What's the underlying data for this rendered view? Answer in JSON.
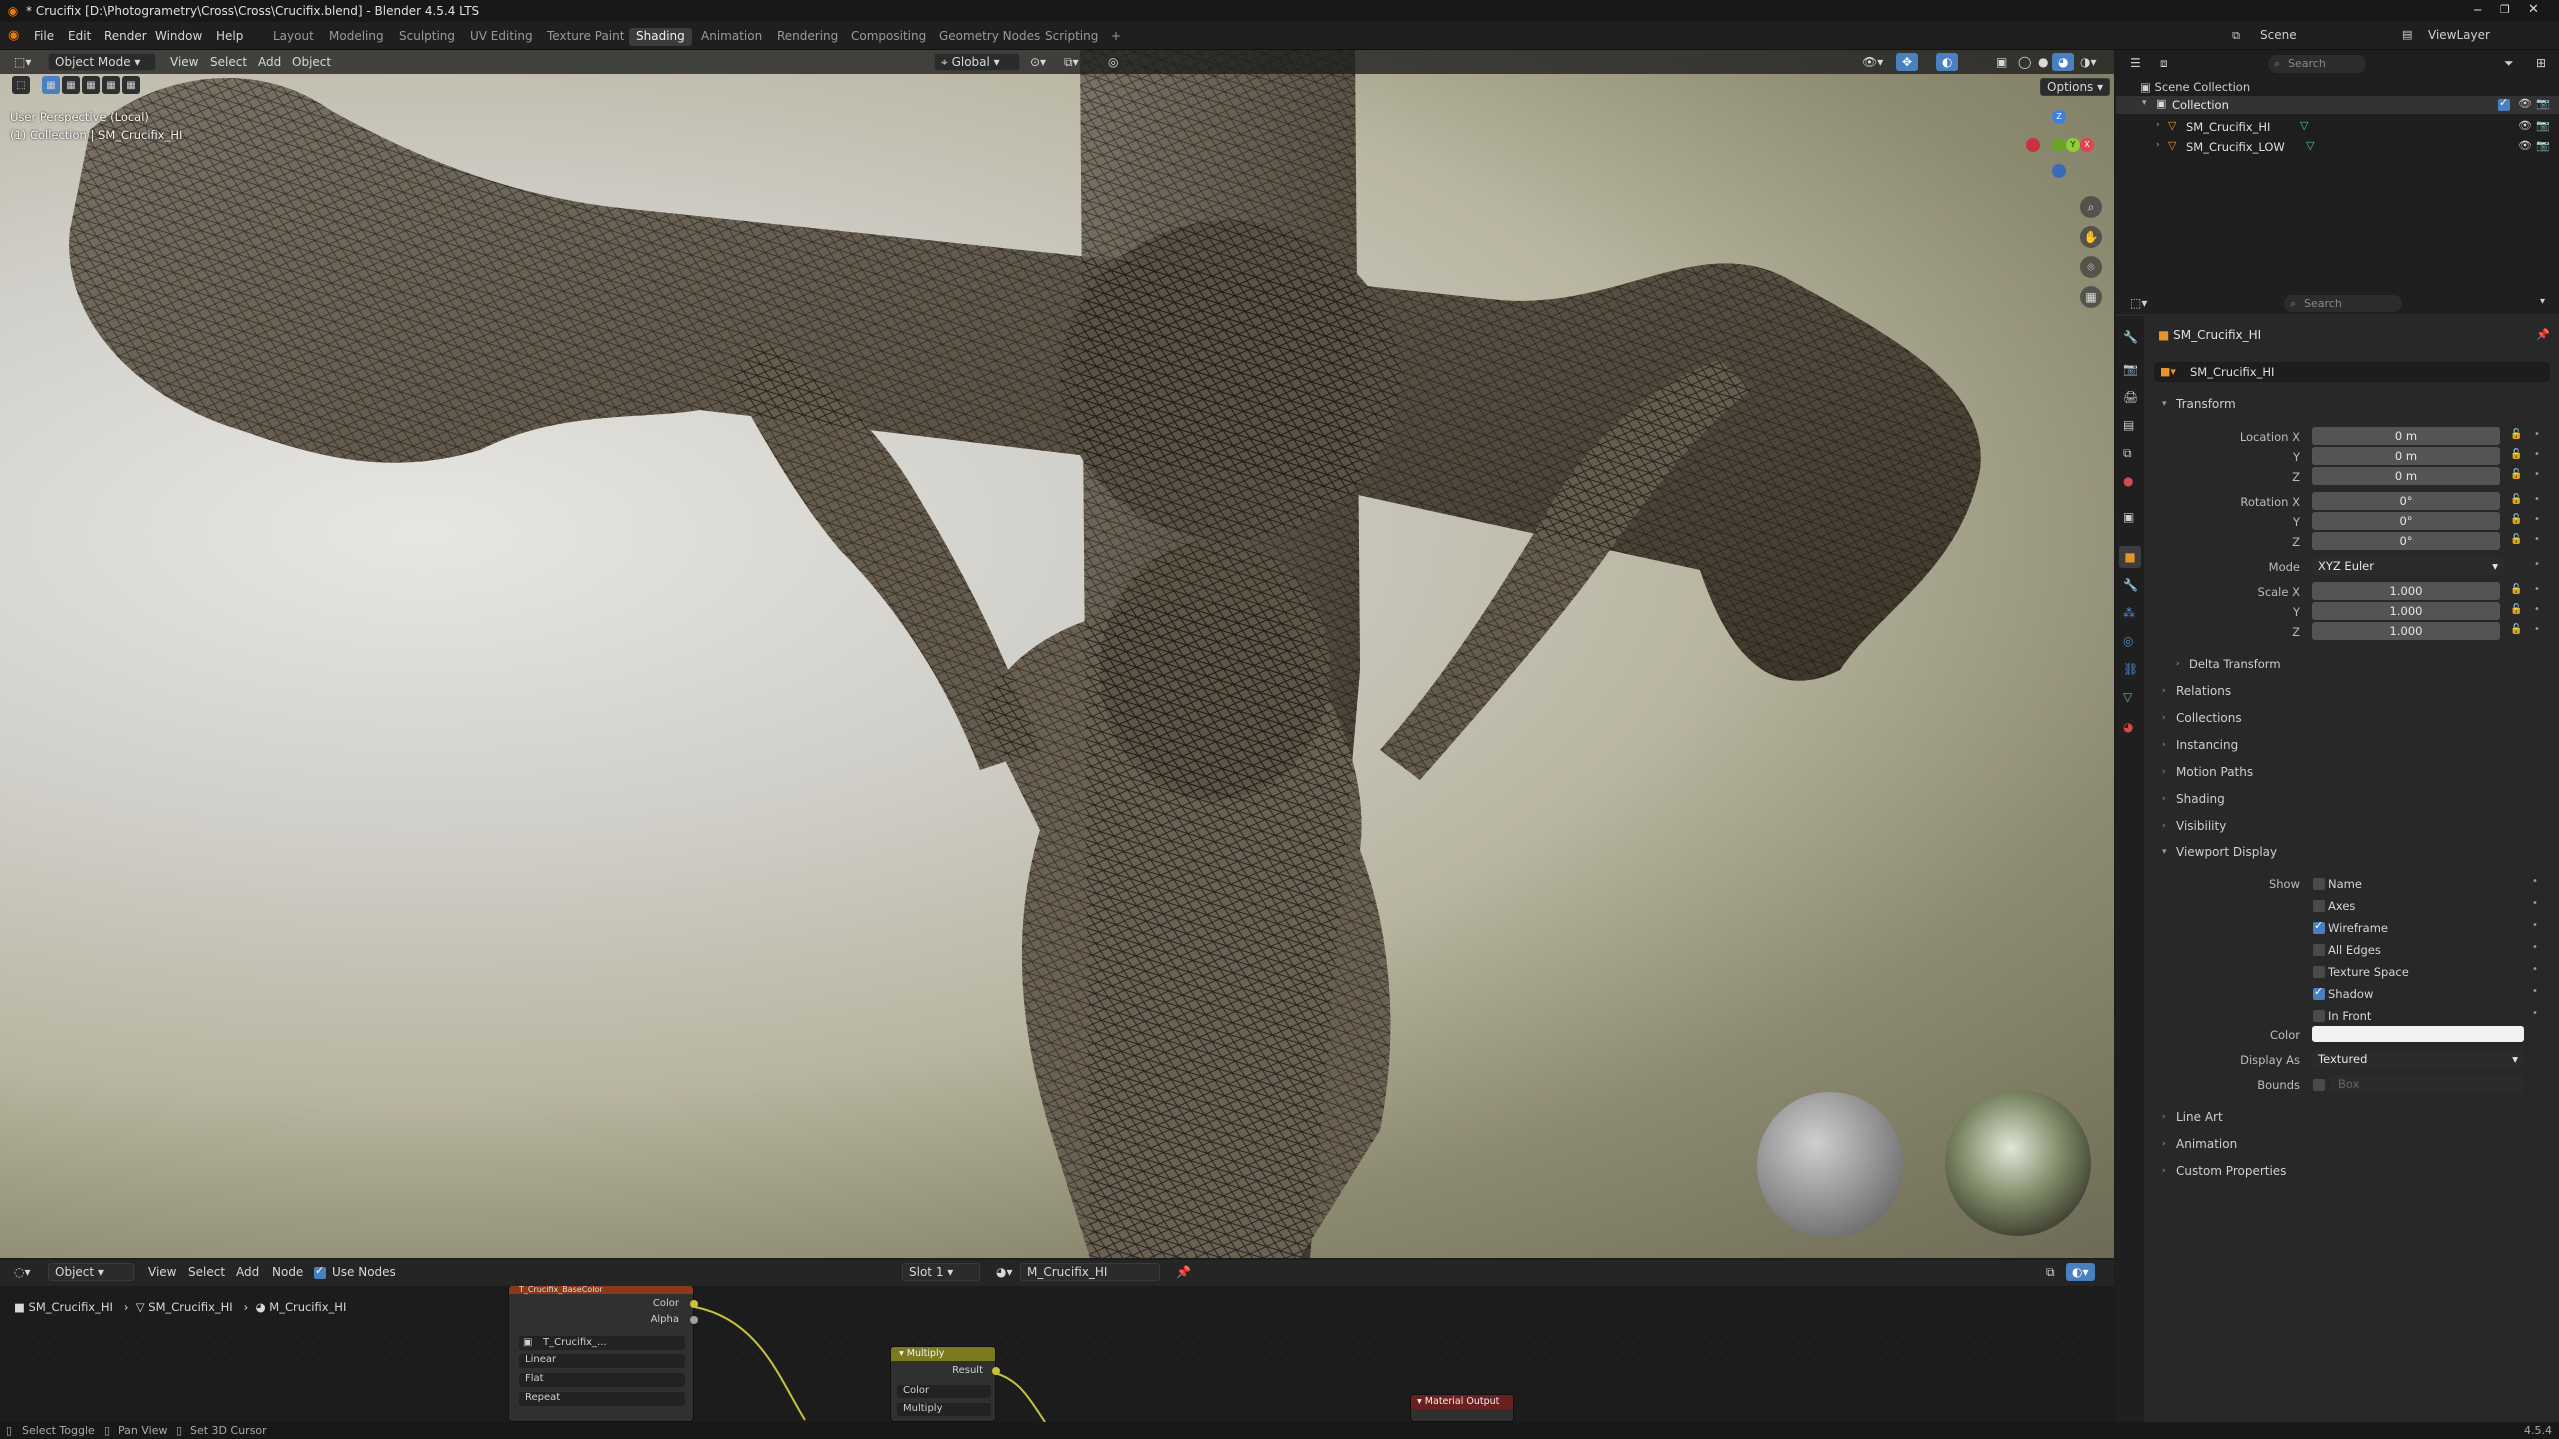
{
  "titlebar": {
    "title": "* Crucifix [D:\\Photogrametry\\Cross\\Cross\\Crucifix.blend] - Blender 4.5.4 LTS",
    "window_controls": [
      "minimize",
      "maximize",
      "close"
    ]
  },
  "menu": [
    "File",
    "Edit",
    "Render",
    "Window",
    "Help"
  ],
  "workspaces": [
    "Layout",
    "Modeling",
    "Sculpting",
    "UV Editing",
    "Texture Paint",
    "Shading",
    "Animation",
    "Rendering",
    "Compositing",
    "Geometry Nodes",
    "Scripting",
    "+"
  ],
  "active_workspace": "Shading",
  "scene": {
    "label": "Scene",
    "viewlayer": "ViewLayer"
  },
  "viewport": {
    "mode": "Object Mode",
    "menus": [
      "View",
      "Select",
      "Add",
      "Object"
    ],
    "orientation": "Global",
    "options": "Options",
    "overlay_line1": "User Perspective (Local)",
    "overlay_line2": "(1) Collection | SM_Crucifix_HI",
    "gizmo_axes": {
      "x": "X",
      "y": "Y",
      "z": "Z"
    }
  },
  "outliner": {
    "root": "Scene Collection",
    "collection": "Collection",
    "items": [
      "SM_Crucifix_HI",
      "SM_Crucifix_LOW"
    ],
    "search_placeholder": "Search"
  },
  "properties": {
    "search_placeholder": "Search",
    "object_name": "SM_Crucifix_HI",
    "datablock": "SM_Crucifix_HI",
    "transform_title": "Transform",
    "location": {
      "label_x": "Location X",
      "label_y": "Y",
      "label_z": "Z",
      "x": "0 m",
      "y": "0 m",
      "z": "0 m"
    },
    "rotation": {
      "label_x": "Rotation X",
      "label_y": "Y",
      "label_z": "Z",
      "x": "0°",
      "y": "0°",
      "z": "0°"
    },
    "mode": {
      "label": "Mode",
      "value": "XYZ Euler"
    },
    "scale": {
      "label_x": "Scale X",
      "label_y": "Y",
      "label_z": "Z",
      "x": "1.000",
      "y": "1.000",
      "z": "1.000"
    },
    "delta": "Delta Transform",
    "panels_collapsed": [
      "Relations",
      "Collections",
      "Instancing",
      "Motion Paths",
      "Shading",
      "Visibility"
    ],
    "viewport_display": {
      "title": "Viewport Display",
      "show_label": "Show",
      "checks": [
        {
          "label": "Name",
          "checked": false
        },
        {
          "label": "Axes",
          "checked": false
        },
        {
          "label": "Wireframe",
          "checked": true
        },
        {
          "label": "All Edges",
          "checked": false
        },
        {
          "label": "Texture Space",
          "checked": false
        },
        {
          "label": "Shadow",
          "checked": true
        },
        {
          "label": "In Front",
          "checked": false
        }
      ],
      "color_label": "Color",
      "color_value": "#f2f2f2",
      "display_as_label": "Display As",
      "display_as": "Textured",
      "bounds_label": "Bounds",
      "bounds_value": "Box"
    },
    "panels_bottom": [
      "Line Art",
      "Animation",
      "Custom Properties"
    ]
  },
  "node_editor": {
    "mode": "Object",
    "menus": [
      "View",
      "Select",
      "Add",
      "Node"
    ],
    "use_nodes": "Use Nodes",
    "slot": "Slot 1",
    "material": "M_Crucifix_HI",
    "breadcrumb": [
      "SM_Crucifix_HI",
      "SM_Crucifix_HI",
      "M_Crucifix_HI"
    ],
    "image_node": {
      "title": "T_Crucifix_BaseColor",
      "out1": "Color",
      "out2": "Alpha",
      "image": "T_Crucifix_...",
      "interp": "Linear",
      "proj": "Flat",
      "ext": "Repeat"
    },
    "math_node": {
      "title": "Multiply",
      "out": "Result",
      "in1": "Color",
      "in2": "Multiply"
    },
    "output_node": {
      "title": "Material Output"
    }
  },
  "status": {
    "items": [
      "Select Toggle",
      "Pan View",
      "Set 3D Cursor"
    ],
    "version": "4.5.4"
  },
  "colors": {
    "accent": "#4a7fc0",
    "active_tab": "#3c3c3c",
    "node_math": "#7c7a1e",
    "node_image": "#8a3a1a",
    "node_output": "#6a2020"
  }
}
